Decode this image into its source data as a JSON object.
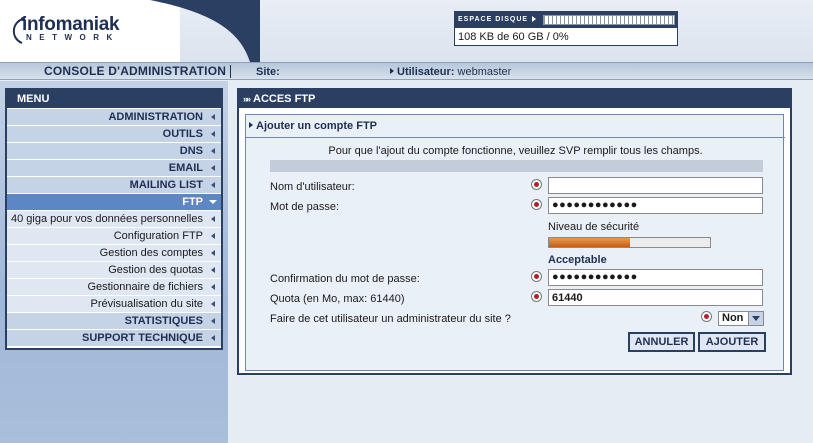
{
  "header": {
    "logo_word": "infomaniak",
    "logo_sub": "NETWORK",
    "disk": {
      "label": "ESPACE DISQUE",
      "value": "108 KB de 60 GB / 0%"
    }
  },
  "console_bar": {
    "title": "CONSOLE D'ADMINISTRATION",
    "site_label": "Site:",
    "site_value": "",
    "user_label": "Utilisateur:",
    "user_value": "webmaster"
  },
  "menu": {
    "title": "MENU",
    "items": [
      {
        "label": "ADMINISTRATION",
        "kind": "section"
      },
      {
        "label": "OUTILS",
        "kind": "section"
      },
      {
        "label": "DNS",
        "kind": "section"
      },
      {
        "label": "EMAIL",
        "kind": "section"
      },
      {
        "label": "MAILING LIST",
        "kind": "section"
      },
      {
        "label": "FTP",
        "kind": "active"
      },
      {
        "label": "40 giga pour vos données personnelles",
        "kind": "sub"
      },
      {
        "label": "Configuration FTP",
        "kind": "sub"
      },
      {
        "label": "Gestion des comptes",
        "kind": "sub"
      },
      {
        "label": "Gestion des quotas",
        "kind": "sub"
      },
      {
        "label": "Gestionnaire de fichiers",
        "kind": "sub"
      },
      {
        "label": "Prévisualisation du site",
        "kind": "sub"
      },
      {
        "label": "STATISTIQUES",
        "kind": "section"
      },
      {
        "label": "SUPPORT TECHNIQUE",
        "kind": "section"
      }
    ]
  },
  "panel": {
    "title": "ACCES FTP",
    "subtitle": "Ajouter un compte FTP",
    "intro": "Pour que l'ajout du compte fonctionne, veuillez SVP remplir tous les champs.",
    "username": {
      "label": "Nom d'utilisateur:",
      "value": ""
    },
    "password": {
      "label": "Mot de passe:",
      "value": "●●●●●●●●●●●●"
    },
    "security": {
      "label": "Niveau de sécurité",
      "level": 0.5,
      "status": "Acceptable"
    },
    "confirm": {
      "label": "Confirmation du mot de passe:",
      "value": "●●●●●●●●●●●●"
    },
    "quota": {
      "label": "Quota (en Mo, max: 61440)",
      "value": "61440"
    },
    "admin": {
      "label": "Faire de cet utilisateur un administrateur du site ?",
      "value": "Non"
    },
    "buttons": {
      "cancel": "ANNULER",
      "add": "AJOUTER"
    }
  },
  "colors": {
    "navy": "#2b3f63",
    "accent": "#5d86c4",
    "required": "#b2202a",
    "meter": "#c85c14"
  }
}
